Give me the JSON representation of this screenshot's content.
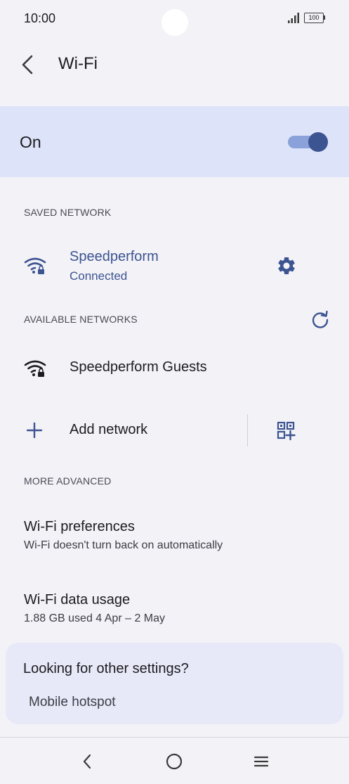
{
  "status_bar": {
    "time": "10:00",
    "battery": "100"
  },
  "app_bar": {
    "title": "Wi-Fi"
  },
  "master_toggle": {
    "label": "On",
    "state": "on"
  },
  "saved_network": {
    "header": "SAVED NETWORK",
    "name": "Speedperform",
    "status": "Connected"
  },
  "available_networks": {
    "header": "AVAILABLE NETWORKS",
    "items": [
      {
        "name": "Speedperform Guests"
      }
    ]
  },
  "add_network": {
    "label": "Add network"
  },
  "more_advanced": {
    "header": "MORE ADVANCED",
    "items": [
      {
        "title": "Wi-Fi preferences",
        "subtitle": "Wi-Fi doesn't turn back on automatically"
      },
      {
        "title": "Wi-Fi data usage",
        "subtitle": "1.88 GB used 4 Apr – 2 May"
      }
    ]
  },
  "other_settings": {
    "title": "Looking for other settings?",
    "link": "Mobile hotspot"
  },
  "colors": {
    "accent": "#3c5491",
    "toggle_bar": "#dde3f8",
    "background": "#f3f2f7"
  }
}
